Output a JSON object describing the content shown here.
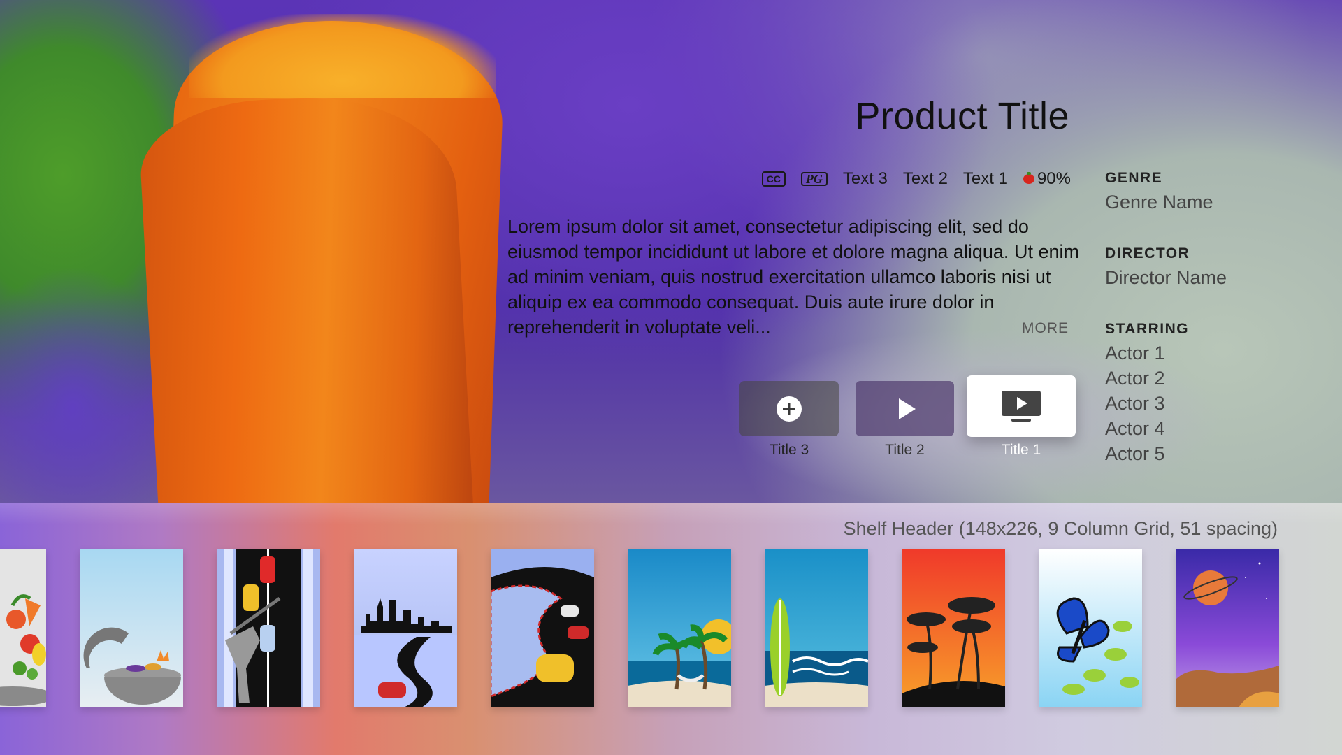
{
  "product": {
    "title": "Product Title",
    "badges": {
      "cc": "CC",
      "rating_badge": "PG"
    },
    "meta_texts": [
      "Text 3",
      "Text 2",
      "Text 1"
    ],
    "score": "90%",
    "description": "Lorem ipsum dolor sit amet, consectetur adipiscing elit, sed do eiusmod tempor incididunt ut labore et dolore magna aliqua. Ut enim ad minim veniam, quis nostrud exercitation ullamco laboris nisi ut aliquip ex ea commodo consequat. Duis aute irure dolor in reprehenderit in voluptate veli...",
    "more_label": "MORE"
  },
  "actions": [
    {
      "label": "Title 3",
      "icon": "add-icon"
    },
    {
      "label": "Title 2",
      "icon": "play-icon"
    },
    {
      "label": "Title 1",
      "icon": "tv-play-icon",
      "focused": true
    }
  ],
  "info": {
    "genre_label": "GENRE",
    "genre": "Genre Name",
    "director_label": "DIRECTOR",
    "director": "Director Name",
    "starring_label": "STARRING",
    "actors": [
      "Actor 1",
      "Actor 2",
      "Actor 3",
      "Actor 4",
      "Actor 5"
    ]
  },
  "shelf": {
    "header": "Shelf Header (148x226, 9 Column Grid, 51 spacing)",
    "posters": [
      "vegetables-poster",
      "barbecue-grill-poster",
      "road-race-cars-poster",
      "city-skyline-road-poster",
      "race-track-poster",
      "beach-hammock-poster",
      "surfboard-beach-poster",
      "palm-sunset-poster",
      "butterfly-poster",
      "planet-space-poster"
    ]
  },
  "colors": {
    "focus_button": "#ffffff",
    "title_text": "#111111",
    "secondary_text": "#444444"
  }
}
